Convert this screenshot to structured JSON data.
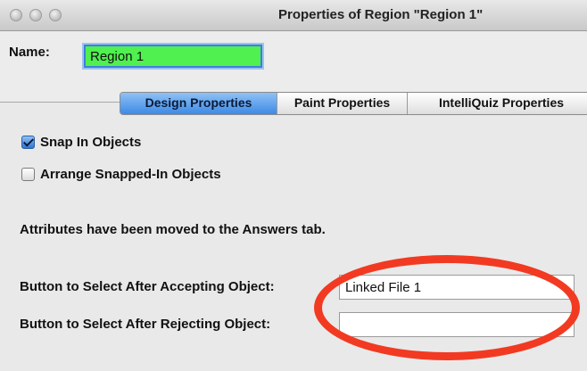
{
  "window": {
    "title": "Properties of Region \"Region 1\""
  },
  "name": {
    "label": "Name:",
    "value": "Region 1"
  },
  "tabs": [
    {
      "label": "Design Properties",
      "active": true
    },
    {
      "label": "Paint Properties",
      "active": false
    },
    {
      "label": "IntelliQuiz Properties",
      "active": false
    }
  ],
  "options": {
    "snap_label": "Snap In Objects",
    "snap_checked": true,
    "arrange_label": "Arrange Snapped-In Objects",
    "arrange_checked": false
  },
  "info_text": "Attributes have been moved to the Answers tab.",
  "fields": {
    "accept_label": "Button to Select After Accepting Object:",
    "accept_value": "Linked File 1",
    "reject_label": "Button to Select After Rejecting Object:",
    "reject_value": ""
  },
  "colors": {
    "name_field_bg": "#4ff04f",
    "active_tab": "#3d8ae6",
    "highlight_oval": "#f23a22"
  }
}
